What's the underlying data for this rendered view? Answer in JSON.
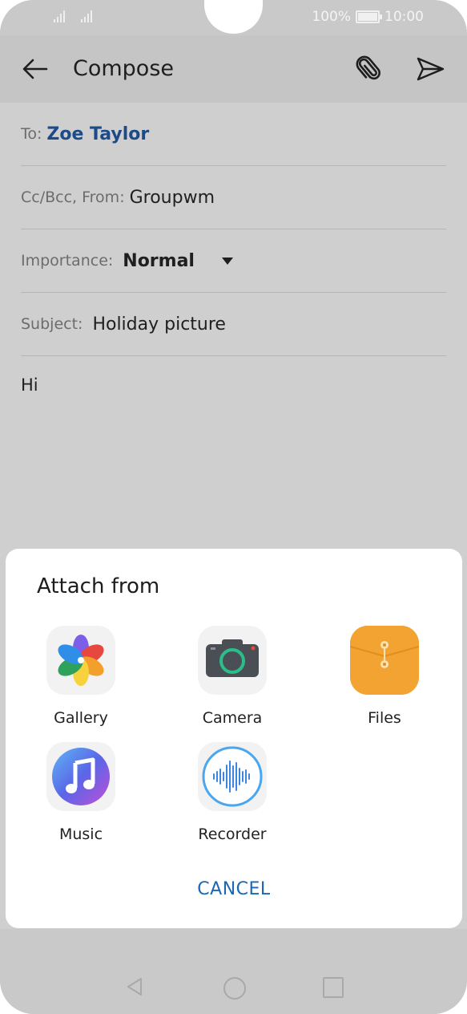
{
  "status_bar": {
    "battery_percent": "100%",
    "time": "10:00"
  },
  "toolbar": {
    "title": "Compose",
    "back_icon": "arrow-left-icon",
    "attach_icon": "paperclip-icon",
    "send_icon": "send-icon"
  },
  "form": {
    "to_label": "To:",
    "to_value": "Zoe Taylor",
    "ccbcc_label": "Cc/Bcc, From:",
    "ccbcc_value": "Groupwm",
    "importance_label": "Importance:",
    "importance_value": "Normal",
    "subject_label": "Subject:",
    "subject_value": "Holiday picture",
    "body": "Hi"
  },
  "attach_sheet": {
    "title": "Attach from",
    "items": [
      {
        "label": "Gallery",
        "icon": "gallery-icon"
      },
      {
        "label": "Camera",
        "icon": "camera-icon"
      },
      {
        "label": "Files",
        "icon": "files-icon"
      },
      {
        "label": "Music",
        "icon": "music-icon"
      },
      {
        "label": "Recorder",
        "icon": "recorder-icon"
      }
    ],
    "cancel_label": "CANCEL"
  },
  "colors": {
    "accent": "#1c66b3",
    "recipient": "#1c4b86",
    "files_orange": "#f2a331"
  }
}
